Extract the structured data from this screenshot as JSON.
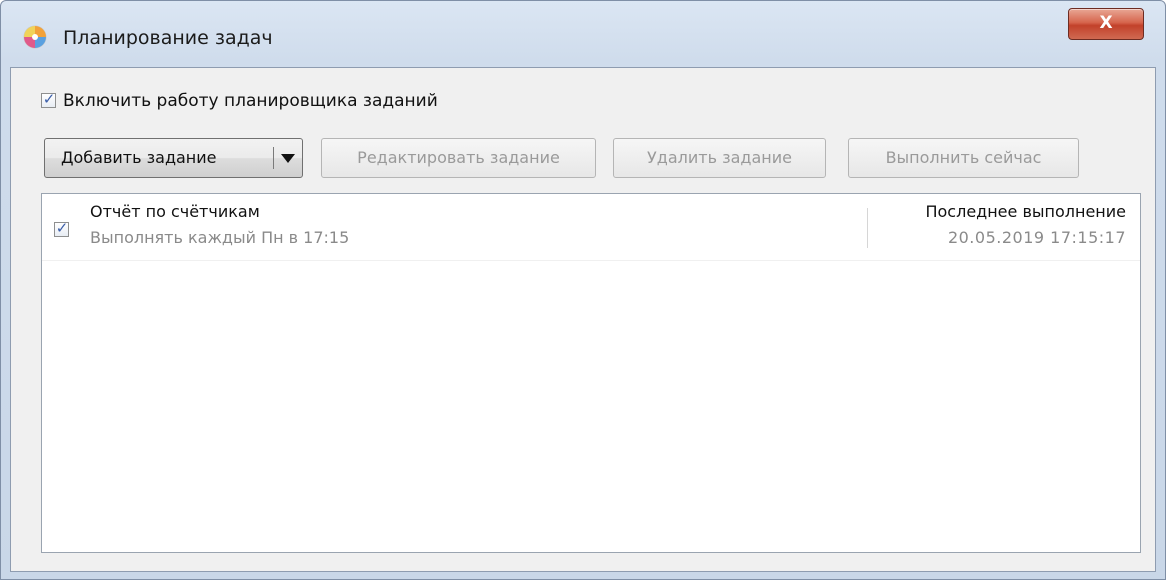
{
  "window": {
    "title": "Планирование задач",
    "close_label": "X",
    "icon": "scheduler-app-icon"
  },
  "scheduler": {
    "enable_label": "Включить работу планировщика заданий",
    "enabled": true
  },
  "toolbar": {
    "add_label": "Добавить задание",
    "edit_label": "Редактировать задание",
    "delete_label": "Удалить задание",
    "run_label": "Выполнить сейчас"
  },
  "tasks": [
    {
      "enabled": true,
      "name": "Отчёт по счётчикам",
      "schedule": "Выполнять каждый Пн в 17:15",
      "last_run_header": "Последнее выполнение",
      "last_run_value": "20.05.2019 17:15:17"
    }
  ],
  "colors": {
    "close_button": "#c2412a",
    "check_mark": "#3b5ea8",
    "disabled_text": "#9a9a9a"
  }
}
